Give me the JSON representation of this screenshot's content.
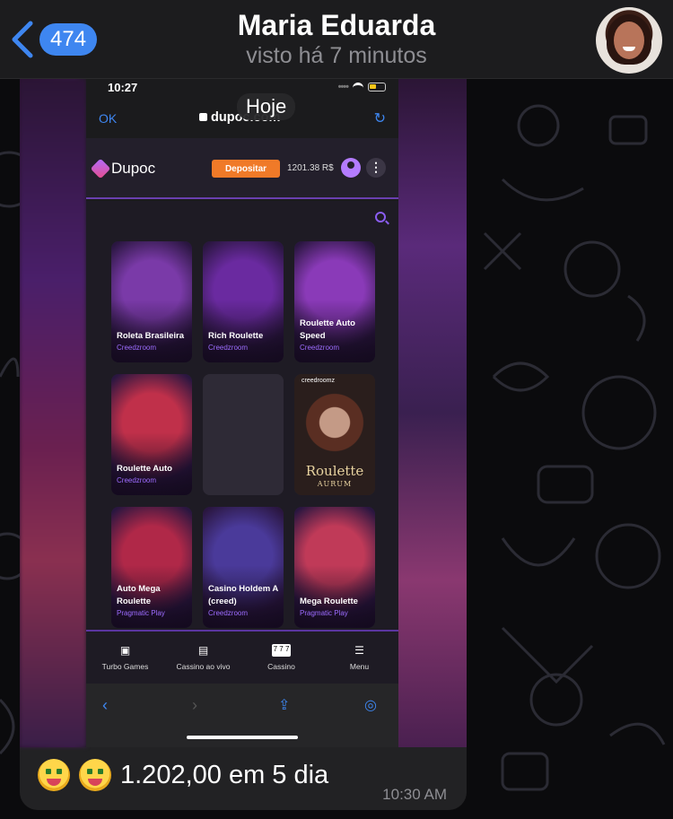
{
  "telegram": {
    "unread_count": "474",
    "chat_name": "Maria Eduarda",
    "status": "visto há 7 minutos",
    "date_pill": "Hoje"
  },
  "phone": {
    "time": "10:27",
    "safari": {
      "ok": "OK",
      "url": "dupoc.com"
    }
  },
  "site": {
    "brand": "Dupoc",
    "deposit": "Depositar",
    "balance": "1201.38 R$",
    "more": "⋮",
    "games": [
      {
        "name": "Roleta Brasileira",
        "provider": "Creedzroom",
        "art": "woman",
        "color": "#7a3aa8"
      },
      {
        "name": "Rich Roulette",
        "provider": "Creedzroom",
        "art": "man",
        "color": "#6a2aa0"
      },
      {
        "name": "Roulette Auto Speed",
        "provider": "Creedzroom",
        "art": "wheel",
        "color": "#8a3ab8"
      },
      {
        "name": "Roulette Auto",
        "provider": "Creedzroom",
        "art": "robot",
        "color": "#c0304a"
      },
      {
        "name": "",
        "provider": "",
        "art": "empty",
        "color": "#2e2a36"
      },
      {
        "name": "",
        "provider": "",
        "art": "aurum",
        "color": "#3a2a26"
      },
      {
        "name": "Auto Mega Roulette",
        "provider": "Pragmatic Play",
        "art": "wheel-red",
        "color": "#b02848"
      },
      {
        "name": "Casino Holdem A (creed)",
        "provider": "Creedzroom",
        "art": "table",
        "color": "#4a3a9a"
      },
      {
        "name": "Mega Roulette",
        "provider": "Pragmatic Play",
        "art": "mega",
        "color": "#c03a58"
      }
    ],
    "aurum_brand": "creedroomz",
    "aurum_title": "Roulette",
    "aurum_sub": "AURUM",
    "nav": [
      {
        "label": "Turbo Games",
        "icon": "turbo-games-icon"
      },
      {
        "label": "Cassino ao vivo",
        "icon": "live-casino-icon"
      },
      {
        "label": "Cassino",
        "icon": "casino-icon"
      },
      {
        "label": "Menu",
        "icon": "menu-icon"
      }
    ]
  },
  "message": {
    "text": "1.202,00 em 5 dia",
    "time": "10:30 AM"
  },
  "colors": {
    "accent": "#3e86f0",
    "deposit": "#f07a28",
    "provider": "#9d6cff"
  }
}
